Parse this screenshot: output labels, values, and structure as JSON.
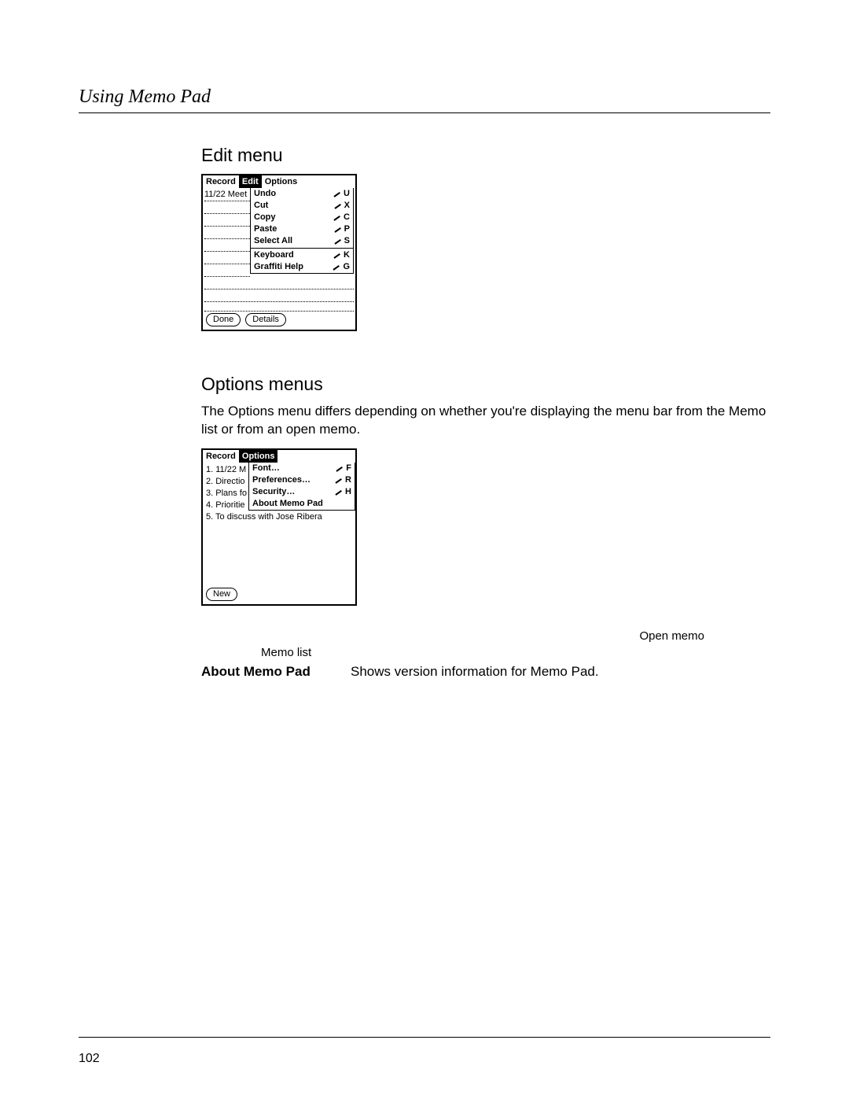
{
  "running_head": "Using Memo Pad",
  "page_number": "102",
  "section1": {
    "heading": "Edit menu",
    "device": {
      "menubar": [
        "Record",
        "Edit",
        "Options"
      ],
      "active": "Edit",
      "first_memo": "11/22 Meet",
      "menu_items": [
        {
          "label": "Undo",
          "sc": "U"
        },
        {
          "label": "Cut",
          "sc": "X"
        },
        {
          "label": "Copy",
          "sc": "C"
        },
        {
          "label": "Paste",
          "sc": "P"
        },
        {
          "label": "Select All",
          "sc": "S"
        }
      ],
      "menu_items2": [
        {
          "label": "Keyboard",
          "sc": "K"
        },
        {
          "label": "Graffiti Help",
          "sc": "G"
        }
      ],
      "buttons": [
        "Done",
        "Details"
      ]
    }
  },
  "section2": {
    "heading": "Options menus",
    "body": "The Options menu differs depending on whether you're displaying the menu bar from the Memo list or from an open memo.",
    "device": {
      "menubar": [
        "Record",
        "Options"
      ],
      "active": "Options",
      "memo_list": [
        "1.  11/22 M",
        "2.  Directio",
        "3.  Plans fo",
        "4.  Prioritie",
        "5.  To discuss with Jose Ribera"
      ],
      "menu_items": [
        {
          "label": "Font…",
          "sc": "F"
        },
        {
          "label": "Preferences…",
          "sc": "R"
        },
        {
          "label": "Security…",
          "sc": "H"
        },
        {
          "label": "About Memo Pad",
          "sc": ""
        }
      ],
      "buttons": [
        "New"
      ]
    },
    "caption_right": "Open memo",
    "caption_left": "Memo list",
    "defn_term": "About Memo Pad",
    "defn_desc": "Shows version information for Memo Pad."
  }
}
